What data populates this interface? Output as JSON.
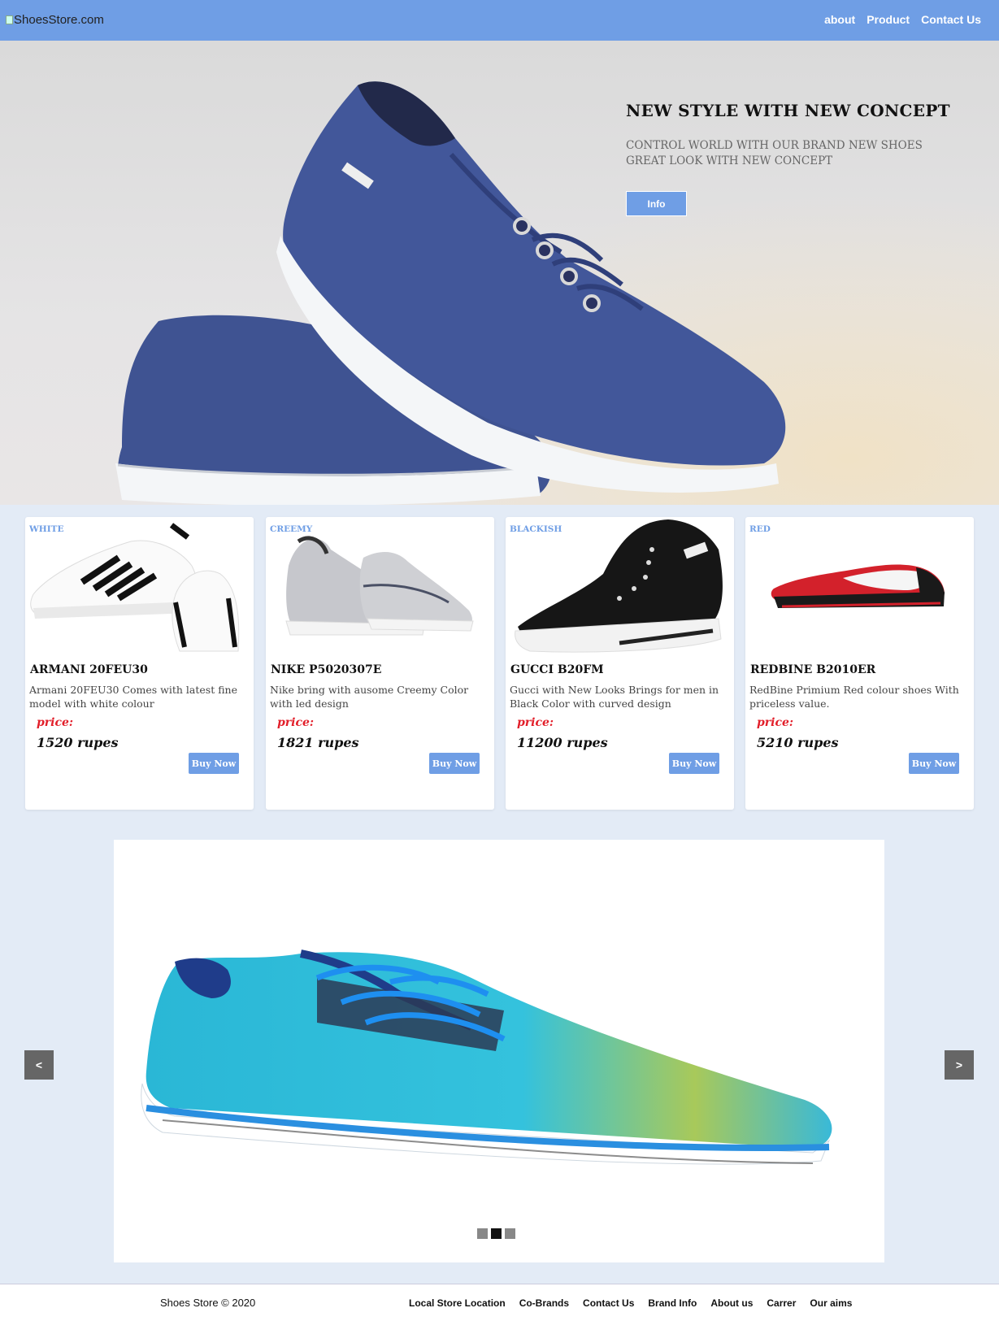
{
  "header": {
    "logo_alt": "ShoesStore.com",
    "nav": [
      "about",
      "Product",
      "Contact Us"
    ]
  },
  "hero": {
    "title": "NEW STYLE WITH NEW CONCEPT",
    "subtitle": "CONTROL WORLD WITH OUR BRAND NEW SHOES GREAT LOOK WITH NEW CONCEPT",
    "button": "Info"
  },
  "products": [
    {
      "tag": "WHITE",
      "name": "ARMANI 20FEU30",
      "desc": "Armani 20FEU30 Comes with latest fine model with white colour",
      "price_label": "price:",
      "price": "1520 rupes",
      "button": "Buy Now"
    },
    {
      "tag": "CREEMY",
      "name": "NIKE P5020307E",
      "desc": "Nike bring with ausome Creemy Color with led design",
      "price_label": "price:",
      "price": "1821 rupes",
      "button": "Buy Now"
    },
    {
      "tag": "BLACKISH",
      "name": "GUCCI B20FM",
      "desc": "Gucci with New Looks Brings for men in Black Color with curved design",
      "price_label": "price:",
      "price": "11200 rupes",
      "button": "Buy Now"
    },
    {
      "tag": "RED",
      "name": "REDBINE B2010ER",
      "desc": "RedBine Primium Red colour shoes With priceless value.",
      "price_label": "price:",
      "price": "5210 rupes",
      "button": "Buy Now"
    }
  ],
  "slider": {
    "prev": "<",
    "next": ">",
    "slide_count": 3,
    "active_slide": 2
  },
  "footer": {
    "copyright": "Shoes Store © 2020",
    "links": [
      "Local Store Location",
      "Co-Brands",
      "Contact Us",
      "Brand Info",
      "About us",
      "Carrer",
      "Our aims"
    ]
  },
  "colors": {
    "accent": "#6f9ee5",
    "page_bg": "#e3ebf6",
    "price_label": "#e21f2a"
  }
}
